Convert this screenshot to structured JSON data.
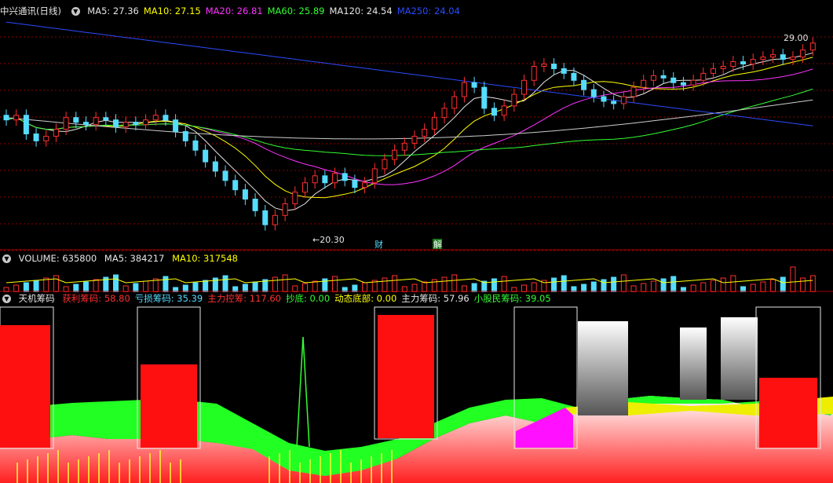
{
  "price_panel": {
    "title": "中兴通讯(日线)",
    "indicators": [
      {
        "label": "MA5: 27.36",
        "color": "#e6e6e6"
      },
      {
        "label": "MA10: 27.15",
        "color": "#ffff00"
      },
      {
        "label": "MA20: 26.81",
        "color": "#ff33ff"
      },
      {
        "label": "MA60: 25.89",
        "color": "#33ff33"
      },
      {
        "label": "MA120: 24.54",
        "color": "#e6e6e6"
      },
      {
        "label": "MA250: 24.04",
        "color": "#2a4bff"
      }
    ],
    "high_label": "29.00",
    "low_label": "20.30",
    "marker_1": "财",
    "marker_2": "解"
  },
  "volume_panel": {
    "label": "VOLUME: 635800",
    "ma5": "MA5: 384217",
    "ma10": "MA10: 317548"
  },
  "chip_panel": {
    "title": "天机筹码",
    "items": [
      {
        "label": "获利筹码: 58.80",
        "color": "#ff3030"
      },
      {
        "label": "亏损筹码: 35.39",
        "color": "#55ddff"
      },
      {
        "label": "主力控筹: 117.60",
        "color": "#ff3030"
      },
      {
        "label": "抄底: 0.00",
        "color": "#33ff33"
      },
      {
        "label": "动态底部: 0.00",
        "color": "#ffff00"
      },
      {
        "label": "主力筹码: 57.96",
        "color": "#e6e6e6"
      },
      {
        "label": "小股民筹码: 39.05",
        "color": "#33ff33"
      }
    ]
  },
  "chart_data": {
    "type": "candlestick",
    "price_range": [
      20.3,
      29.0
    ],
    "closes": [
      25.2,
      25.4,
      24.6,
      24.3,
      24.5,
      24.8,
      25.3,
      25.1,
      25.0,
      25.3,
      25.2,
      24.9,
      25.1,
      25.0,
      25.2,
      25.4,
      25.2,
      24.7,
      24.3,
      23.9,
      23.4,
      23.0,
      22.6,
      22.2,
      21.8,
      21.3,
      20.7,
      21.1,
      21.6,
      22.1,
      22.5,
      22.8,
      22.5,
      22.9,
      22.6,
      22.3,
      22.5,
      23.1,
      23.5,
      23.9,
      24.2,
      24.5,
      24.8,
      25.3,
      25.7,
      26.2,
      26.8,
      26.6,
      25.7,
      25.4,
      25.8,
      26.3,
      26.9,
      27.5,
      27.6,
      27.4,
      27.2,
      26.9,
      26.5,
      26.2,
      26.0,
      25.9,
      26.2,
      26.6,
      26.9,
      27.1,
      27.0,
      26.8,
      26.7,
      26.9,
      27.2,
      27.4,
      27.5,
      27.7,
      27.6,
      27.8,
      27.9,
      28.0,
      27.8,
      27.9,
      28.2,
      28.5
    ],
    "ma_lines": [
      "MA5",
      "MA10",
      "MA20",
      "MA60",
      "MA120",
      "MA250"
    ],
    "volume": {
      "last": 635800,
      "ma5": 384217,
      "ma10": 317548
    }
  }
}
